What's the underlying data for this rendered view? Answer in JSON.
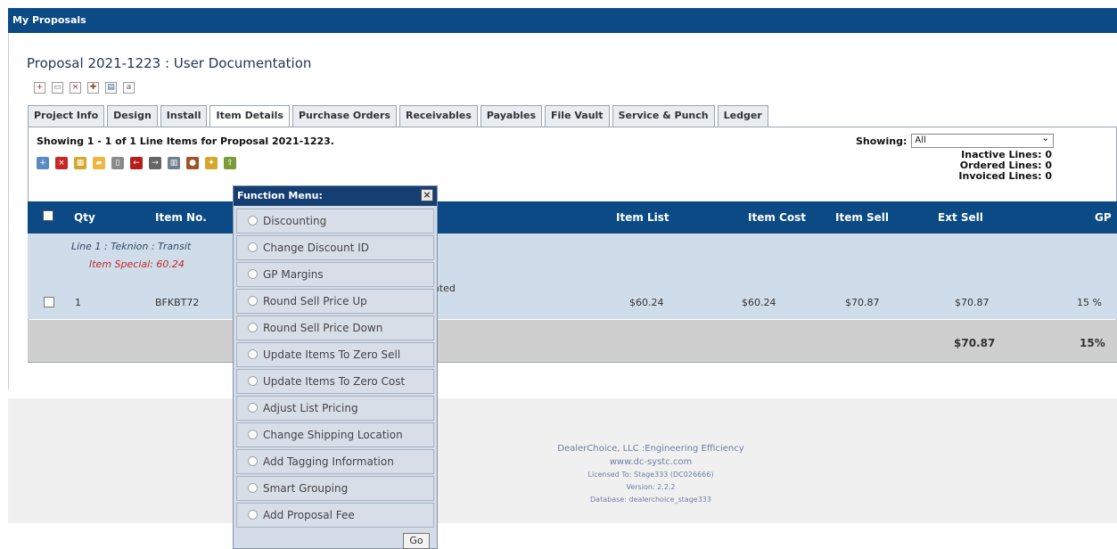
{
  "header": {
    "title": "My Proposals"
  },
  "proposal": {
    "title": "Proposal 2021-1223 : User Documentation"
  },
  "tabs": [
    {
      "label": "Project Info"
    },
    {
      "label": "Design"
    },
    {
      "label": "Install"
    },
    {
      "label": "Item Details"
    },
    {
      "label": "Purchase Orders"
    },
    {
      "label": "Receivables"
    },
    {
      "label": "Payables"
    },
    {
      "label": "File Vault"
    },
    {
      "label": "Service & Punch"
    },
    {
      "label": "Ledger"
    }
  ],
  "list": {
    "showing_text": "Showing 1 - 1 of 1 Line Items for Proposal 2021-1223.",
    "showing_label": "Showing:",
    "showing_value": "All",
    "inactive_lines": "Inactive Lines: 0",
    "ordered_lines": "Ordered Lines: 0",
    "invoiced_lines": "Invoiced Lines: 0"
  },
  "table": {
    "headers": [
      "Qty",
      "Item No.",
      "Item List",
      "Item Cost",
      "Item Sell",
      "Ext Sell",
      "GP"
    ],
    "line_note": "Line 1 : Teknion : Transit",
    "item_special": "Item Special: 60.24",
    "related_text": "plated",
    "row": {
      "qty": "1",
      "item_no": "BFKBT72",
      "item_list": "$60.24",
      "item_cost": "$60.24",
      "item_sell": "$70.87",
      "ext_sell": "$70.87",
      "gp": "15 %"
    },
    "total_ext_sell": "$70.87",
    "total_gp": "15%"
  },
  "function_menu": {
    "title": "Function Menu:",
    "items": [
      {
        "label": "Discounting"
      },
      {
        "label": "Change Discount ID"
      },
      {
        "label": "GP Margins"
      },
      {
        "label": "Round Sell Price Up"
      },
      {
        "label": "Round Sell Price Down"
      },
      {
        "label": "Update Items To Zero Sell"
      },
      {
        "label": "Update Items To Zero Cost"
      },
      {
        "label": "Adjust List Pricing"
      },
      {
        "label": "Change Shipping Location"
      },
      {
        "label": "Add Tagging Information"
      },
      {
        "label": "Smart Grouping"
      },
      {
        "label": "Add Proposal Fee"
      }
    ],
    "go_label": "Go"
  },
  "footer": {
    "line1": "DealerChoice, LLC :Engineering Efficiency",
    "line2": "www.dc-systc.com",
    "line3": "Licensed To: Stage333 (DC026666)",
    "line4": "Version: 2.2.2",
    "line5": "Database: dealerchoice_stage333"
  },
  "icons": {
    "title_icons": [
      "plus-icon",
      "document-icon",
      "delete-icon",
      "tools-icon",
      "copy-icon",
      "lock-icon"
    ],
    "toolbar_icons": [
      "add-icon",
      "remove-icon",
      "tree-icon",
      "folder-icon",
      "document-icon",
      "arrow-icon",
      "forward-icon",
      "grid-icon",
      "user-icon",
      "gear-icon",
      "export-icon"
    ]
  }
}
